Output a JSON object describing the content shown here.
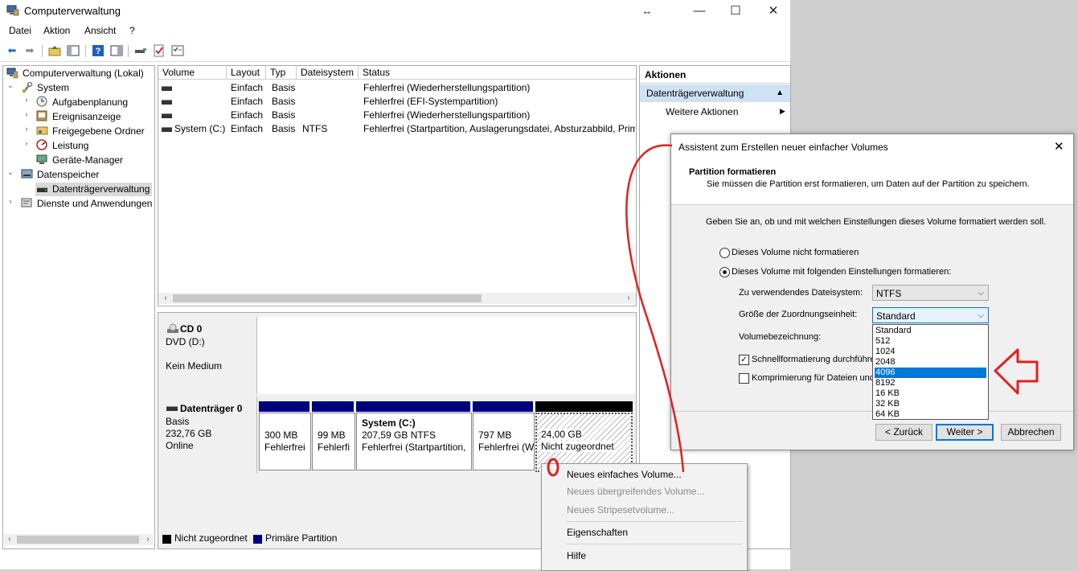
{
  "window": {
    "title": "Computerverwaltung",
    "menu": [
      "Datei",
      "Aktion",
      "Ansicht",
      "?"
    ],
    "resize_glyph": "↔",
    "controls": {
      "minimize": "—",
      "maximize": "☐",
      "close": "✕"
    }
  },
  "tree": {
    "items": [
      {
        "label": "Computerverwaltung (Lokal)",
        "icon": "computer-icon"
      },
      {
        "label": "System",
        "icon": "tools-icon"
      },
      {
        "label": "Aufgabenplanung",
        "icon": "clock-icon"
      },
      {
        "label": "Ereignisanzeige",
        "icon": "event-viewer-icon"
      },
      {
        "label": "Freigegebene Ordner",
        "icon": "shared-folder-icon"
      },
      {
        "label": "Leistung",
        "icon": "performance-icon"
      },
      {
        "label": "Geräte-Manager",
        "icon": "device-manager-icon"
      },
      {
        "label": "Datenspeicher",
        "icon": "storage-icon"
      },
      {
        "label": "Datenträgerverwaltung",
        "icon": "disk-management-icon"
      },
      {
        "label": "Dienste und Anwendungen",
        "icon": "services-icon"
      }
    ]
  },
  "volumes": {
    "columns": [
      "Volume",
      "Layout",
      "Typ",
      "Dateisystem",
      "Status"
    ],
    "rows": [
      {
        "volume": "",
        "layout": "Einfach",
        "typ": "Basis",
        "fs": "",
        "status": "Fehlerfrei (Wiederherstellungspartition)"
      },
      {
        "volume": "",
        "layout": "Einfach",
        "typ": "Basis",
        "fs": "",
        "status": "Fehlerfrei (EFI-Systempartition)"
      },
      {
        "volume": "",
        "layout": "Einfach",
        "typ": "Basis",
        "fs": "",
        "status": "Fehlerfrei (Wiederherstellungspartition)"
      },
      {
        "volume": "System (C:)",
        "layout": "Einfach",
        "typ": "Basis",
        "fs": "NTFS",
        "status": "Fehlerfrei (Startpartition, Auslagerungsdatei, Absturzabbild, Prim"
      }
    ]
  },
  "cd": {
    "name": "CD 0",
    "type": "DVD (D:)",
    "media": "Kein Medium"
  },
  "disk0": {
    "name": "Datenträger 0",
    "type": "Basis",
    "size": "232,76 GB",
    "state": "Online",
    "partitions": [
      {
        "title": "",
        "size": "300 MB",
        "status": "Fehlerfrei"
      },
      {
        "title": "",
        "size": "99 MB",
        "status": "Fehlerfi"
      },
      {
        "title": "System  (C:)",
        "size": "207,59 GB NTFS",
        "status": "Fehlerfrei (Startpartition,"
      },
      {
        "title": "",
        "size": "797 MB",
        "status": "Fehlerfrei (W"
      },
      {
        "title": "",
        "size": "24,00 GB",
        "status": "Nicht zugeordnet"
      }
    ]
  },
  "legend": {
    "unallocated": "Nicht zugeordnet",
    "primary": "Primäre Partition"
  },
  "actions": {
    "header": "Aktionen",
    "section": "Datenträgerverwaltung",
    "more": "Weitere Aktionen"
  },
  "context_menu": {
    "items": [
      {
        "label": "Neues einfaches Volume...",
        "enabled": true
      },
      {
        "label": "Neues übergreifendes Volume...",
        "enabled": false
      },
      {
        "label": "Neues Stripesetvolume...",
        "enabled": false
      },
      {
        "label": "Eigenschaften",
        "enabled": true
      },
      {
        "label": "Hilfe",
        "enabled": true
      }
    ]
  },
  "dialog": {
    "title": "Assistent zum Erstellen neuer einfacher Volumes",
    "heading": "Partition formatieren",
    "subheading": "Sie müssen die Partition erst formatieren, um Daten auf der Partition zu speichern.",
    "instruction": "Geben Sie an, ob und mit welchen Einstellungen dieses Volume formatiert werden soll.",
    "radio_no_format": "Dieses Volume nicht formatieren",
    "radio_format": "Dieses Volume mit folgenden Einstellungen formatieren:",
    "fs_label": "Zu verwendendes Dateisystem:",
    "fs_value": "NTFS",
    "alloc_label": "Größe der Zuordnungseinheit:",
    "alloc_value": "Standard",
    "alloc_options": [
      "Standard",
      "512",
      "1024",
      "2048",
      "4096",
      "8192",
      "16 KB",
      "32 KB",
      "64 KB"
    ],
    "alloc_highlighted": "4096",
    "volname_label": "Volumebezeichnung:",
    "quick_format": "Schnellformatierung durchführen",
    "compress": "Komprimierung für Dateien und O",
    "btn_back": "< Zurück",
    "btn_next": "Weiter >",
    "btn_cancel": "Abbrechen"
  },
  "colors": {
    "primary_partition": "#00007f",
    "unallocated": "#000000",
    "selection": "#0078d7",
    "annotation": "#e02020",
    "actions_section": "#cfe2f3"
  }
}
